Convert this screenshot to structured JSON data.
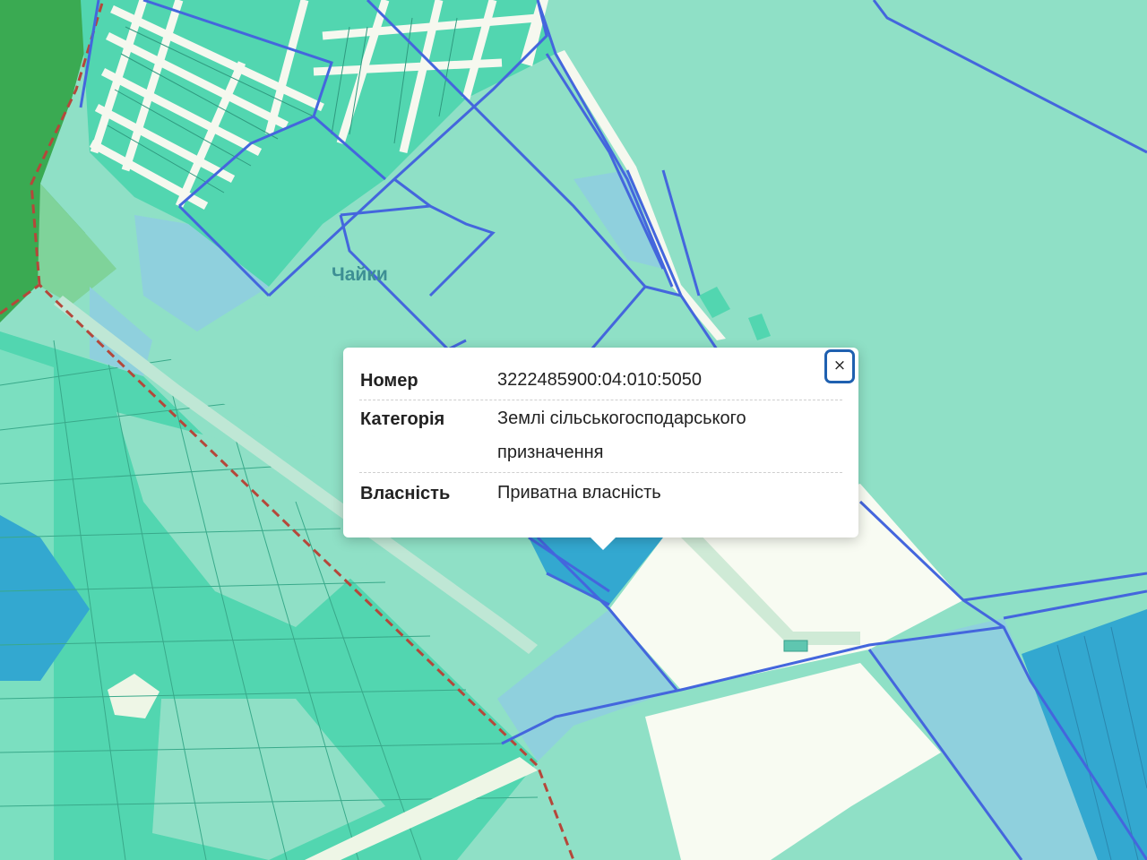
{
  "map": {
    "place_label": "Чайки",
    "colors": {
      "background": "#8fe0c6",
      "parcel_green": "#52d6b0",
      "parcel_dark": "#3cc79e",
      "parcel_blue": "#8fd0dd",
      "parcel_selected": "#33a8d0",
      "road": "#f6f8ef",
      "forest": "#3aaa52",
      "boundary_line": "#4466dd",
      "admin_border": "#b5473a"
    }
  },
  "popup": {
    "close_label": "×",
    "rows": [
      {
        "key": "Номер",
        "value": "3222485900:04:010:5050"
      },
      {
        "key": "Категорія",
        "value": "Землі сільськогосподарського призначення"
      },
      {
        "key": "Власність",
        "value": "Приватна власність"
      }
    ]
  }
}
